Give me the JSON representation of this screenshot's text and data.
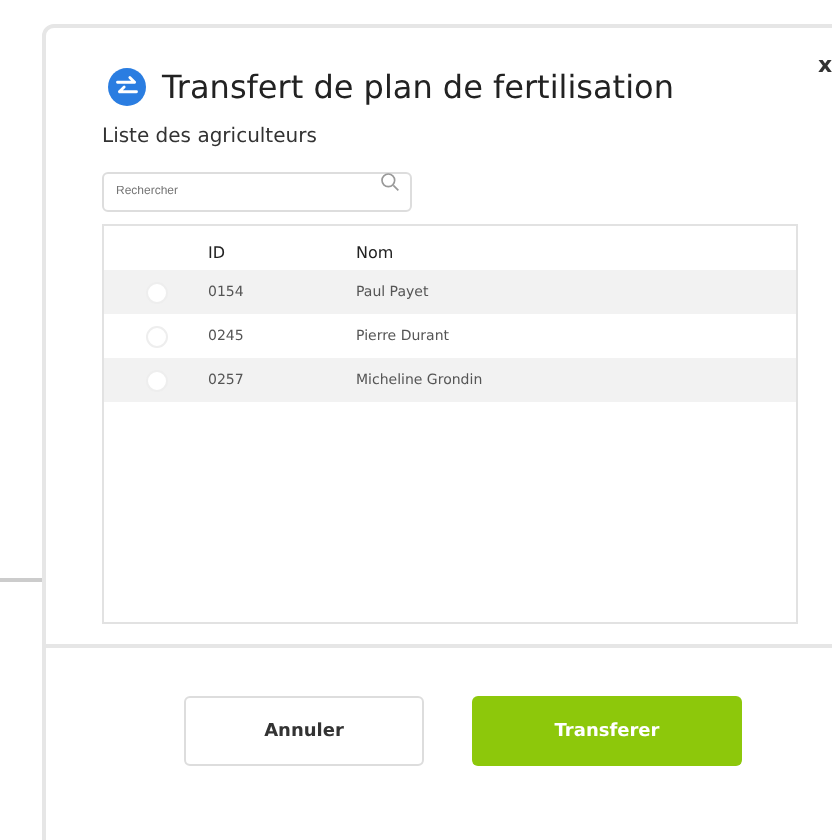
{
  "dialog": {
    "title": "Transfert de plan de fertilisation",
    "close": "x",
    "list_label": "Liste des agriculteurs",
    "search": {
      "placeholder": "Rechercher"
    },
    "table": {
      "columns": [
        "ID",
        "Nom"
      ],
      "rows": [
        {
          "id": "0154",
          "name": "Paul Payet",
          "selected": false
        },
        {
          "id": "0245",
          "name": "Pierre Durant",
          "selected": false
        },
        {
          "id": "0257",
          "name": "Micheline Grondin",
          "selected": false
        }
      ]
    },
    "buttons": [
      {
        "label": "Annuler",
        "kind": "secondary"
      },
      {
        "label": "Transferer",
        "kind": "primary"
      }
    ]
  }
}
